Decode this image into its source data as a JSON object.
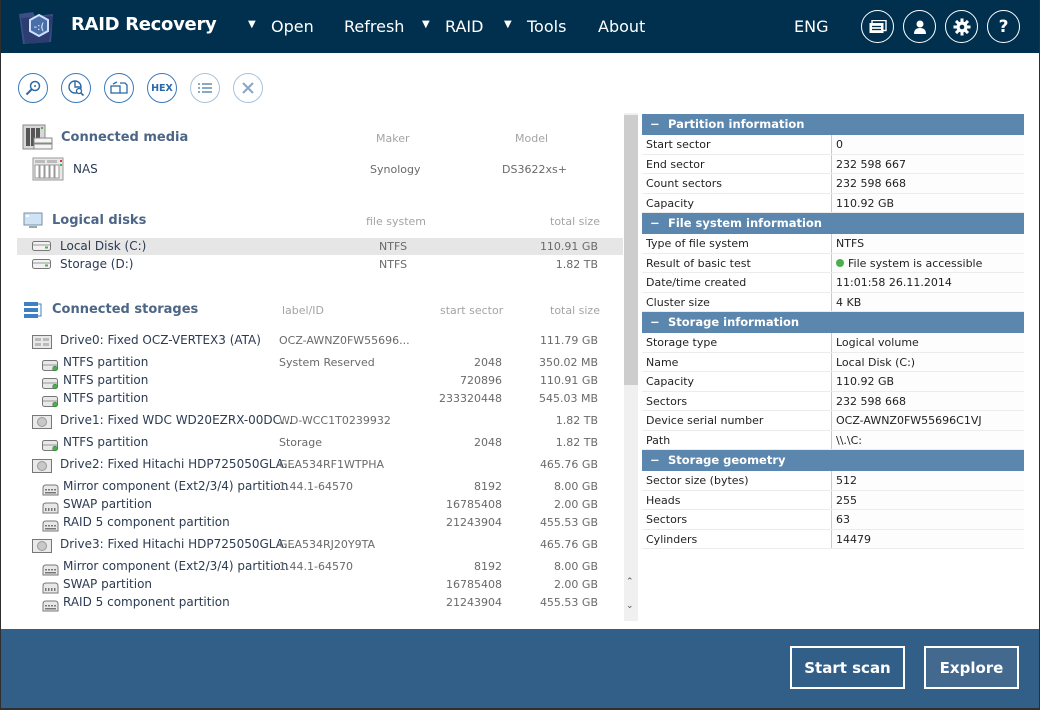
{
  "app": {
    "title": "RAID Recovery"
  },
  "menu": {
    "open": "Open",
    "refresh": "Refresh",
    "raid": "RAID",
    "tools": "Tools",
    "about": "About",
    "language": "ENG"
  },
  "header_icons": [
    "messages-icon",
    "user-icon",
    "settings-icon",
    "help-icon"
  ],
  "toolbar": [
    {
      "name": "search-icon",
      "enabled": true
    },
    {
      "name": "partition-search-icon",
      "enabled": true
    },
    {
      "name": "image-icon",
      "enabled": true
    },
    {
      "name": "hex-icon",
      "label": "HEX",
      "enabled": true
    },
    {
      "name": "list-icon",
      "enabled": false
    },
    {
      "name": "close-icon",
      "enabled": false
    }
  ],
  "connected_media": {
    "title": "Connected media",
    "columns": {
      "maker": "Maker",
      "model": "Model"
    },
    "items": [
      {
        "name": "NAS",
        "maker": "Synology",
        "model": "DS3622xs+"
      }
    ]
  },
  "logical_disks": {
    "title": "Logical disks",
    "columns": {
      "fs": "file system",
      "size": "total size"
    },
    "items": [
      {
        "name": "Local Disk (C:)",
        "fs": "NTFS",
        "size": "110.91 GB",
        "selected": true
      },
      {
        "name": "Storage (D:)",
        "fs": "NTFS",
        "size": "1.82 TB",
        "selected": false
      }
    ]
  },
  "connected_storages": {
    "title": "Connected storages",
    "columns": {
      "label": "label/ID",
      "start": "start sector",
      "size": "total size"
    },
    "drives": [
      {
        "name": "Drive0: Fixed OCZ-VERTEX3 (ATA)",
        "label": "OCZ-AWNZ0FW55696...",
        "size": "111.79 GB",
        "partitions": [
          {
            "name": "NTFS partition",
            "label": "System Reserved",
            "start": "2048",
            "size": "350.02 MB"
          },
          {
            "name": "NTFS partition",
            "label": "",
            "start": "720896",
            "size": "110.91 GB"
          },
          {
            "name": "NTFS partition",
            "label": "",
            "start": "233320448",
            "size": "545.03 MB"
          }
        ]
      },
      {
        "name": "Drive1: Fixed WDC WD20EZRX-00DC...",
        "label": "WD-WCC1T0239932",
        "size": "1.82 TB",
        "partitions": [
          {
            "name": "NTFS partition",
            "label": "Storage",
            "start": "2048",
            "size": "1.82 TB"
          }
        ]
      },
      {
        "name": "Drive2: Fixed Hitachi HDP725050GLA...",
        "label": "GEA534RF1WTPHA",
        "size": "465.76 GB",
        "partitions": [
          {
            "name": "Mirror component (Ext2/3/4) partition",
            "label": "1.44.1-64570",
            "start": "8192",
            "size": "8.00 GB"
          },
          {
            "name": "SWAP partition",
            "label": "",
            "start": "16785408",
            "size": "2.00 GB"
          },
          {
            "name": "RAID 5 component partition",
            "label": "",
            "start": "21243904",
            "size": "455.53 GB"
          }
        ]
      },
      {
        "name": "Drive3: Fixed Hitachi HDP725050GLA...",
        "label": "GEA534RJ20Y9TA",
        "size": "465.76 GB",
        "partitions": [
          {
            "name": "Mirror component (Ext2/3/4) partition",
            "label": "1.44.1-64570",
            "start": "8192",
            "size": "8.00 GB"
          },
          {
            "name": "SWAP partition",
            "label": "",
            "start": "16785408",
            "size": "2.00 GB"
          },
          {
            "name": "RAID 5 component partition",
            "label": "",
            "start": "21243904",
            "size": "455.53 GB"
          }
        ]
      }
    ]
  },
  "properties": [
    {
      "title": "Partition information",
      "rows": [
        {
          "key": "Start sector",
          "value": "0"
        },
        {
          "key": "End sector",
          "value": "232 598 667"
        },
        {
          "key": "Count sectors",
          "value": "232 598 668"
        },
        {
          "key": "Capacity",
          "value": "110.92 GB"
        }
      ]
    },
    {
      "title": "File system information",
      "rows": [
        {
          "key": "Type of file system",
          "value": "NTFS"
        },
        {
          "key": "Result of basic test",
          "value": "File system is accessible",
          "status": "ok"
        },
        {
          "key": "Date/time created",
          "value": "11:01:58 26.11.2014"
        },
        {
          "key": "Cluster size",
          "value": "4 KB"
        }
      ]
    },
    {
      "title": "Storage information",
      "rows": [
        {
          "key": "Storage type",
          "value": "Logical volume"
        },
        {
          "key": "Name",
          "value": "Local Disk (C:)"
        },
        {
          "key": "Capacity",
          "value": "110.92 GB"
        },
        {
          "key": "Sectors",
          "value": "232 598 668"
        },
        {
          "key": "Device serial number",
          "value": "OCZ-AWNZ0FW55696C1VJ"
        },
        {
          "key": "Path",
          "value": "\\\\.\\C:"
        }
      ]
    },
    {
      "title": "Storage geometry",
      "rows": [
        {
          "key": "Sector size (bytes)",
          "value": "512"
        },
        {
          "key": "Heads",
          "value": "255"
        },
        {
          "key": "Sectors",
          "value": "63"
        },
        {
          "key": "Cylinders",
          "value": "14479"
        }
      ]
    }
  ],
  "footer": {
    "start_scan": "Start scan",
    "explore": "Explore"
  },
  "colors": {
    "header": "#01304f",
    "footer": "#315f88",
    "section_header": "#5b86ad",
    "status_ok": "#4cae4c"
  }
}
